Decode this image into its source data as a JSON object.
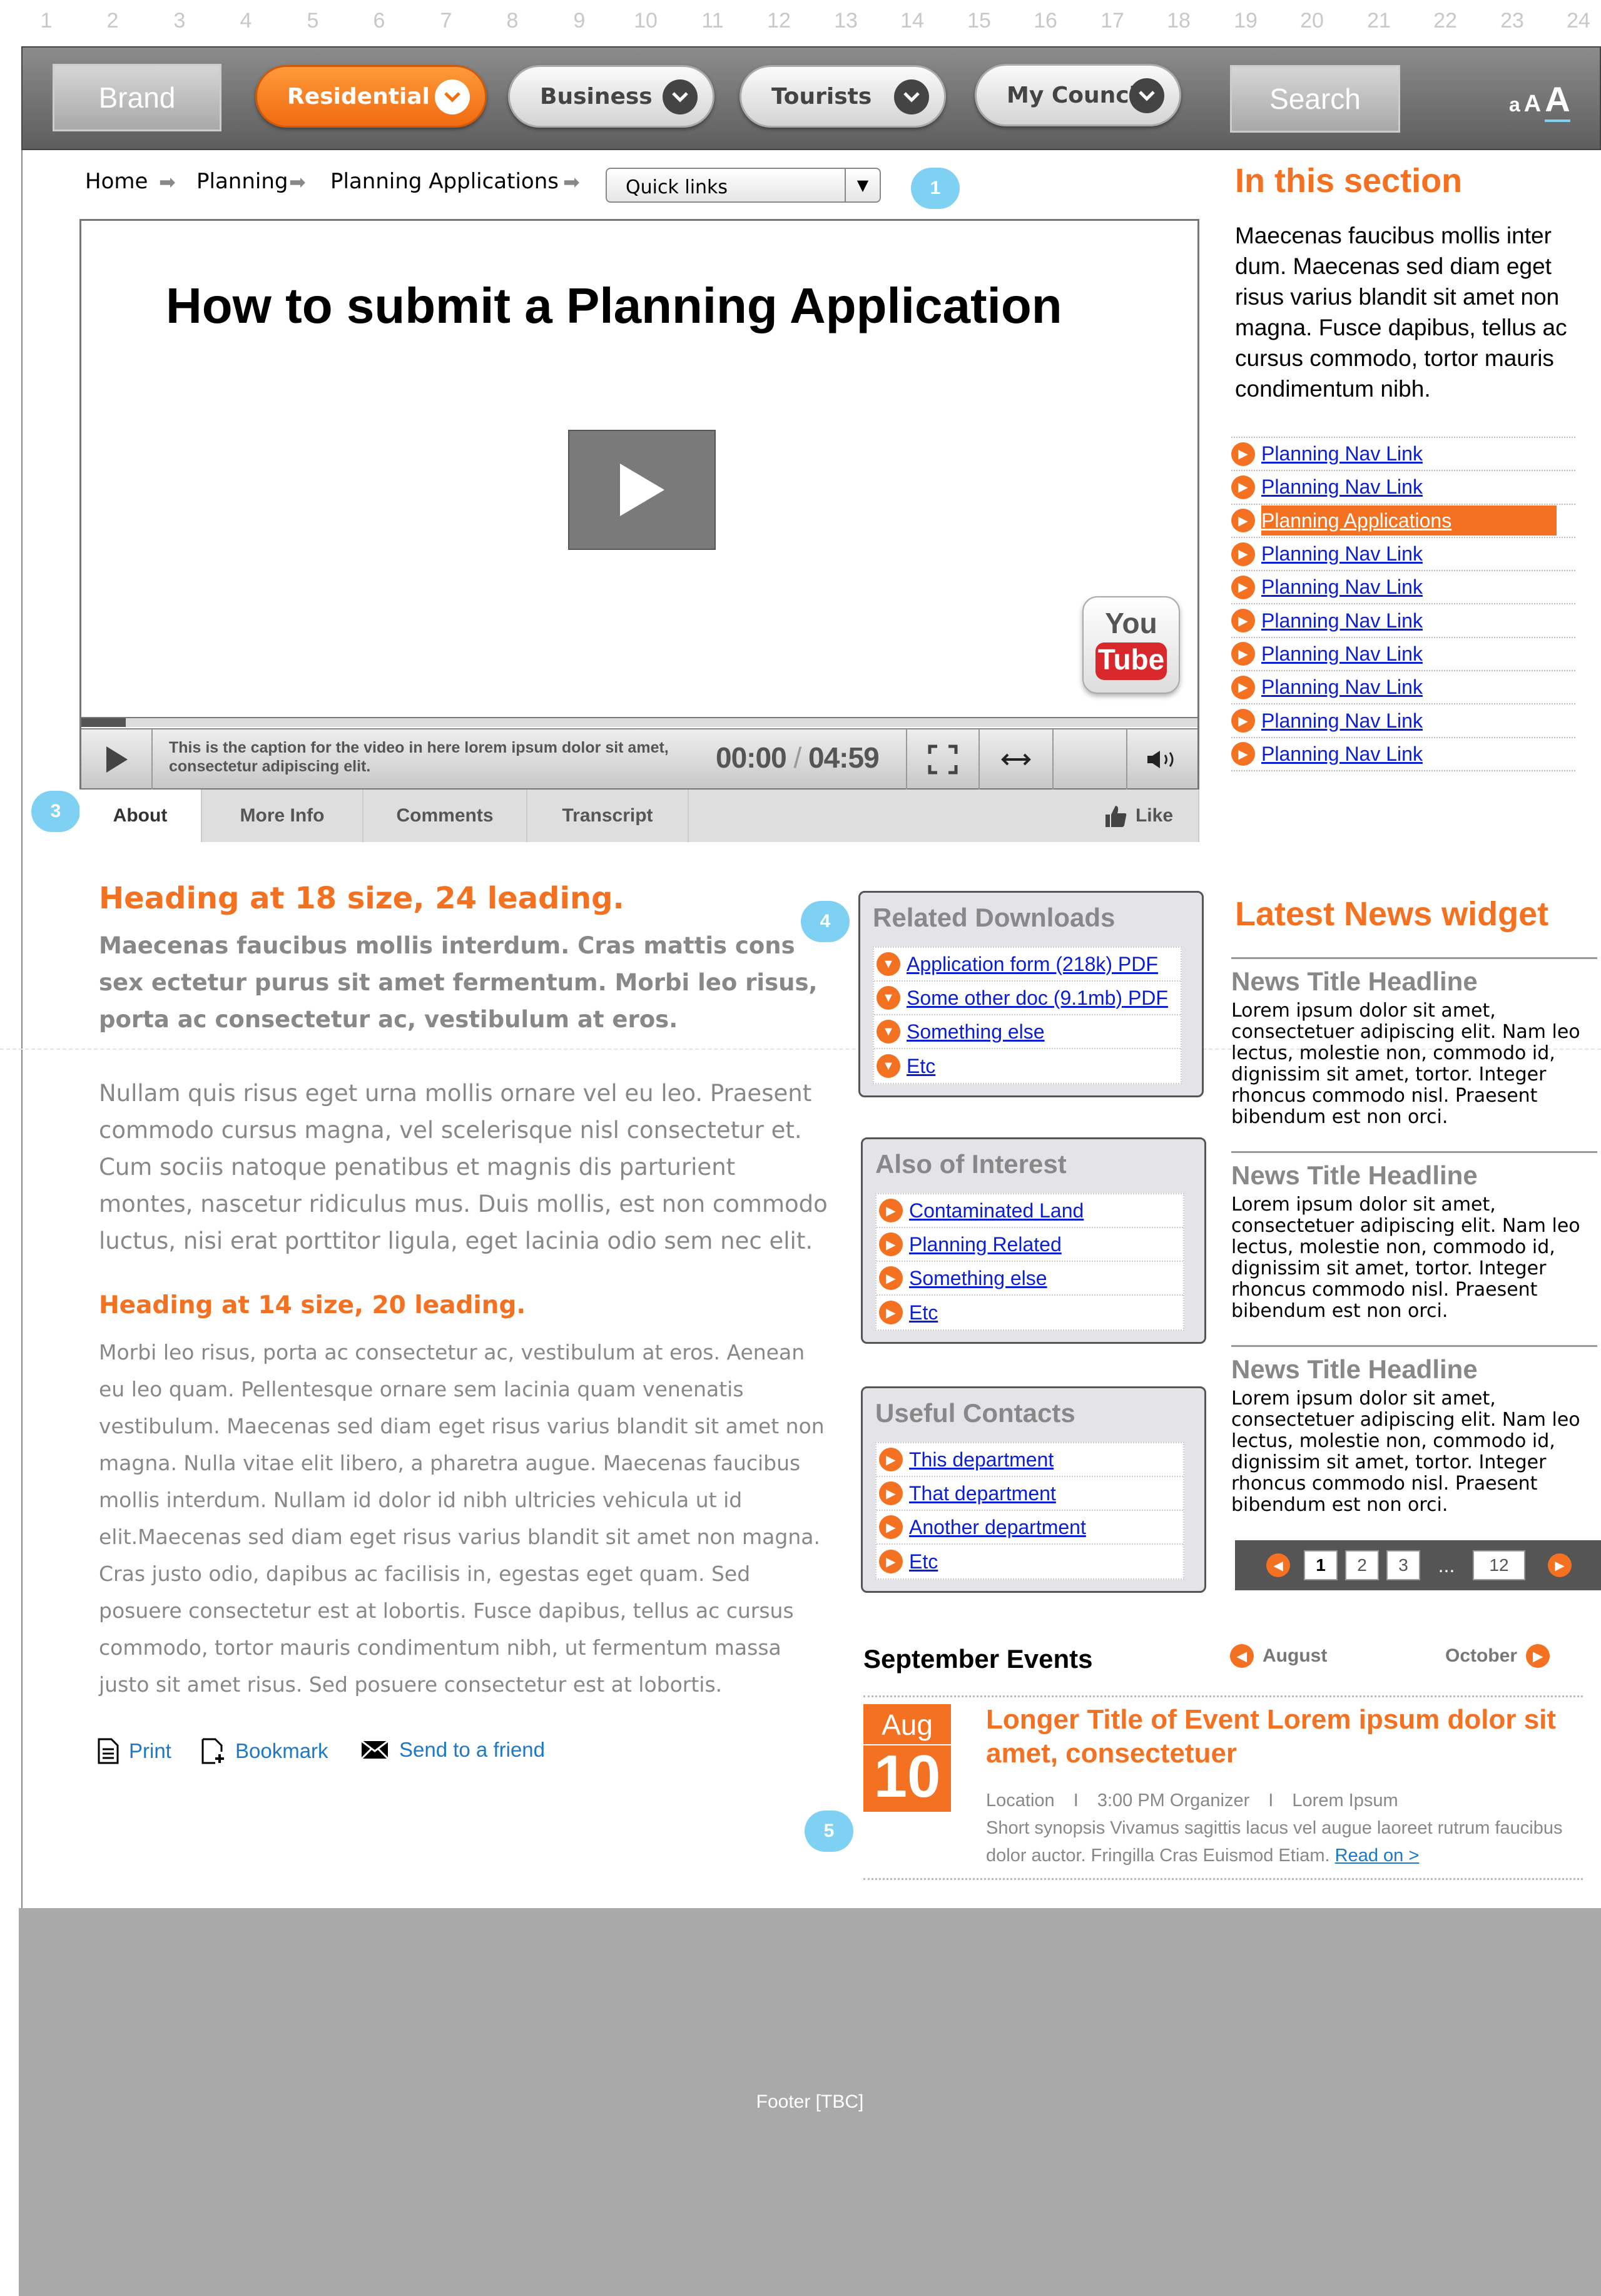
{
  "grid_numbers": [
    "1",
    "2",
    "3",
    "4",
    "5",
    "6",
    "7",
    "8",
    "9",
    "10",
    "11",
    "12",
    "13",
    "14",
    "15",
    "16",
    "17",
    "18",
    "19",
    "20",
    "21",
    "22",
    "23",
    "24"
  ],
  "header": {
    "brand": "Brand",
    "nav": [
      {
        "label": "Residential"
      },
      {
        "label": "Business"
      },
      {
        "label": "Tourists"
      },
      {
        "label": "My Council"
      }
    ],
    "search_label": "Search",
    "font_size_a1": "a",
    "font_size_a2": "A",
    "font_size_a3": "A"
  },
  "breadcrumb": {
    "items": [
      "Home",
      "Planning",
      "Planning Applications"
    ],
    "quick_links": "Quick links"
  },
  "annotations": [
    "1",
    "3",
    "4",
    "5"
  ],
  "video": {
    "title": "How to submit a Planning Application",
    "caption": "This is the caption for the video in here lorem ipsum dolor sit amet, consectetur adipiscing elit.",
    "current_time": "00:00",
    "separator": "/",
    "duration": "04:59",
    "yt_top": "You",
    "yt_bottom": "Tube",
    "progress_fraction": 0.04
  },
  "tabs": [
    {
      "label": "About"
    },
    {
      "label": "More Info"
    },
    {
      "label": "Comments"
    },
    {
      "label": "Transcript"
    }
  ],
  "like_label": "Like",
  "content": {
    "heading18": "Heading at 18 size, 24 leading.",
    "lead": "Maecenas faucibus mollis interdum. Cras mattis cons sex ectetur purus sit amet fermentum. Morbi leo risus, porta ac consectetur ac, vestibulum at eros.",
    "para1": "Nullam quis risus eget urna mollis ornare vel eu leo. Praesent commodo cursus magna, vel scelerisque nisl consectetur et. Cum sociis natoque penatibus et magnis dis parturient montes, nascetur ridiculus mus. Duis mollis, est non commodo luctus, nisi erat porttitor ligula, eget lacinia odio sem nec elit.",
    "heading14": "Heading at 14 size, 20 leading.",
    "para2": "Morbi leo risus, porta ac consectetur ac, vestibulum at eros. Aenean eu leo quam. Pellentesque ornare sem lacinia quam venenatis vestibulum. Maecenas sed diam eget risus varius blandit sit amet non magna. Nulla vitae elit libero, a pharetra augue. Maecenas faucibus mollis interdum. Nullam id dolor id nibh ultricies vehicula ut id elit.Maecenas sed diam eget risus varius blandit sit amet non magna. Cras justo odio, dapibus ac facilisis in, egestas eget quam. Sed posuere consectetur est at lobortis. Fusce dapibus, tellus ac cursus commodo, tortor mauris condimentum nibh, ut fermentum massa justo sit amet risus. Sed posuere consectetur est at lobortis.",
    "tools": {
      "print": "Print",
      "bookmark": "Bookmark",
      "send": "Send to a friend"
    }
  },
  "related_downloads": {
    "title": "Related Downloads",
    "items": [
      "Application form (218k) PDF",
      "Some other doc (9.1mb) PDF",
      "Something else",
      "Etc"
    ]
  },
  "also_of_interest": {
    "title": "Also of Interest",
    "items": [
      "Contaminated Land",
      "Planning Related",
      "Something else",
      "Etc"
    ]
  },
  "useful_contacts": {
    "title": "Useful Contacts",
    "items": [
      "This department",
      "That department",
      "Another department",
      "Etc"
    ]
  },
  "sidebar": {
    "title": "In this section",
    "intro": "Maecenas faucibus mollis inter dum. Maecenas sed diam eget risus varius blandit sit amet non magna. Fusce dapibus, tellus ac cursus commodo, tortor mauris condimentum nibh.",
    "nav": [
      "Planning Nav Link",
      "Planning Nav Link",
      "Planning Applications",
      "Planning Nav Link",
      "Planning Nav Link",
      "Planning Nav Link",
      "Planning Nav Link",
      "Planning Nav Link",
      "Planning Nav Link",
      "Planning Nav Link"
    ],
    "selected_index": 2
  },
  "news": {
    "title": "Latest News widget",
    "items": [
      {
        "headline": "News Title Headline",
        "body": "Lorem ipsum dolor sit amet, consectetuer adipiscing elit. Nam leo lectus, molestie non, commodo id, dignissim sit amet, tortor. Integer rhoncus commodo nisl. Praesent bibendum est non orci."
      },
      {
        "headline": "News Title Headline",
        "body": "Lorem ipsum dolor sit amet, consectetuer adipiscing elit. Nam leo lectus, molestie non, commodo id, dignissim sit amet, tortor. Integer rhoncus commodo nisl. Praesent bibendum est non orci."
      },
      {
        "headline": "News Title Headline",
        "body": "Lorem ipsum dolor sit amet, consectetuer adipiscing elit. Nam leo lectus, molestie non, commodo id, dignissim sit amet, tortor. Integer rhoncus commodo nisl. Praesent bibendum est non orci."
      }
    ],
    "pager": {
      "pages": [
        "1",
        "2",
        "3"
      ],
      "ellipsis": "...",
      "last": "12",
      "current": "1"
    }
  },
  "events": {
    "title": "September Events",
    "prev": "August",
    "next": "October",
    "month": "Aug",
    "day": "10",
    "event_title": "Longer Title of Event Lorem ipsum dolor sit amet, consectetuer",
    "location": "Location",
    "sep": "I",
    "time_org": "3:00 PM Organizer",
    "extra": "Lorem Ipsum",
    "synopsis": "Short synopsis Vivamus sagittis lacus vel augue laoreet rutrum faucibus dolor auctor. Fringilla Cras Euismod Etiam.",
    "read_on": "Read on >"
  },
  "footer": "Footer [TBC]",
  "colors": {
    "accent": "#f37120",
    "link": "#0a1ed6",
    "bubble": "#7ed1f3",
    "footer": "#a9a9a9"
  }
}
